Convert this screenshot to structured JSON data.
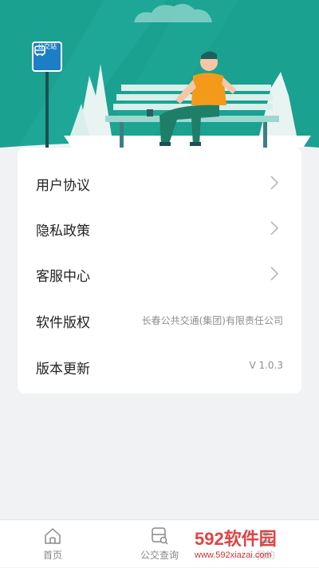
{
  "hero": {
    "sign_label": "公交站",
    "colors": {
      "teal": "#1aa190",
      "sign_blue": "#1c7ec4",
      "shirt": "#f39a1b"
    }
  },
  "menu": [
    {
      "label": "用户协议",
      "icon": "chevron-right-icon"
    },
    {
      "label": "隐私政策",
      "icon": "chevron-right-icon"
    },
    {
      "label": "客服中心",
      "icon": "chevron-right-icon"
    },
    {
      "label": "软件版权",
      "value": "长春公共交通(集团)有限责任公司"
    },
    {
      "label": "版本更新",
      "value": "V 1.0.3"
    }
  ],
  "tabbar": {
    "items": [
      {
        "label": "首页",
        "icon": "home-icon"
      },
      {
        "label": "公交查询",
        "icon": "bus-search-icon"
      },
      {
        "label": "我的",
        "icon": "user-icon"
      }
    ]
  },
  "watermark": {
    "main": "592软件园",
    "sub": "www.592xiazai.com"
  }
}
